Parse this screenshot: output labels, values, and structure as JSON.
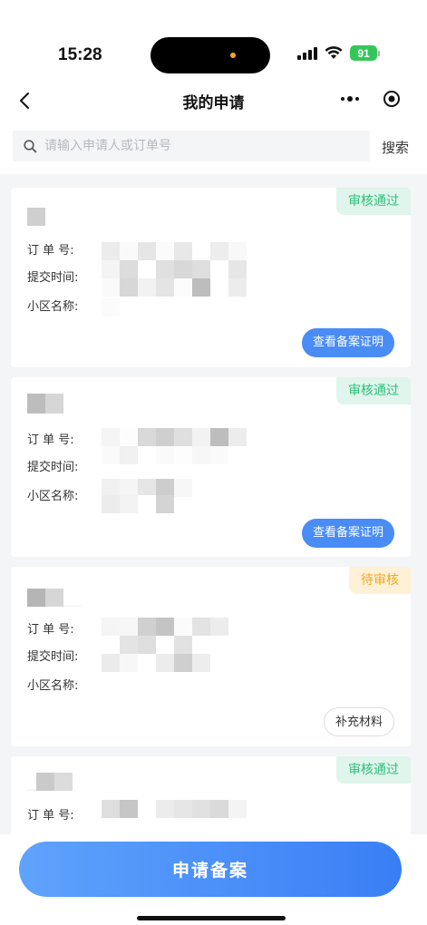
{
  "status": {
    "time": "15:28",
    "battery": "91"
  },
  "nav": {
    "title": "我的申请"
  },
  "search": {
    "placeholder": "请输入申请人或订单号",
    "button": "搜索"
  },
  "labels": {
    "order_no": "订 单 号:",
    "submit_time": "提交时间:",
    "community": "小区名称:"
  },
  "cards": [
    {
      "status": "审核通过",
      "status_type": "pass",
      "action": "查看备案证明"
    },
    {
      "status": "审核通过",
      "status_type": "pass",
      "action": "查看备案证明"
    },
    {
      "status": "待审核",
      "status_type": "pending",
      "action": "补充材料"
    },
    {
      "status": "审核通过",
      "status_type": "pass"
    }
  ],
  "bottom": {
    "apply_label": "申请备案"
  }
}
